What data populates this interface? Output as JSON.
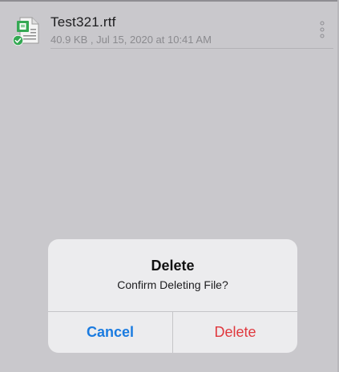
{
  "file": {
    "name": "Test321.rtf",
    "meta": "40.9 KB , Jul 15, 2020 at 10:41 AM",
    "icon": "rtf-file-icon",
    "status_icon": "synced-check-icon",
    "more_icon": "more-vertical-icon"
  },
  "dialog": {
    "title": "Delete",
    "message": "Confirm Deleting File?",
    "cancel_label": "Cancel",
    "delete_label": "Delete"
  },
  "colors": {
    "accent_blue": "#1a7be0",
    "destructive_red": "#e0383e",
    "file_green": "#34a853",
    "overlay_bg": "#c9c8cc"
  }
}
